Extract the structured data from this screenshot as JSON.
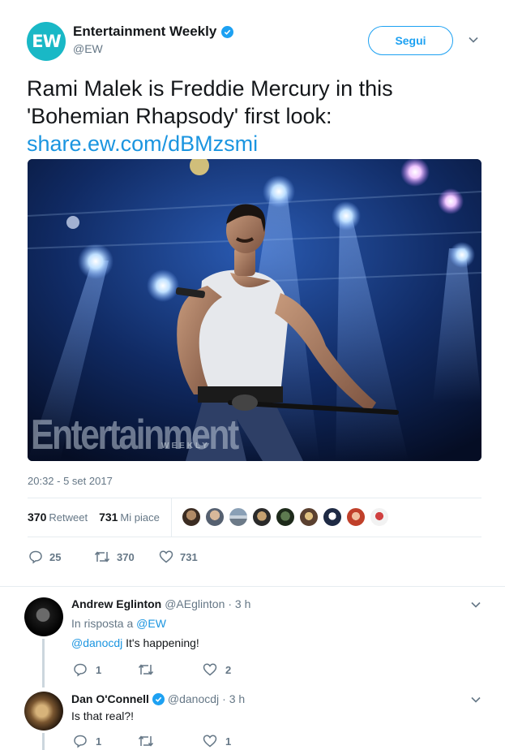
{
  "tweet": {
    "author": {
      "name": "Entertainment Weekly",
      "handle": "@EW",
      "avatar_text": "EW",
      "verified": true
    },
    "follow_label": "Segui",
    "text": "Rami Malek is Freddie Mercury in this 'Bohemian Rhapsody' first look:",
    "link": "share.ew.com/dBMzsmi",
    "image": {
      "watermark": "Entertainment",
      "watermark_sub": "WEEKLY"
    },
    "timestamp": "20:32 - 5 set 2017",
    "stats": {
      "retweets_count": "370",
      "retweets_label": "Retweet",
      "likes_count": "731",
      "likes_label": "Mi piace"
    },
    "actions": {
      "reply": "25",
      "retweet": "370",
      "like": "731"
    }
  },
  "replies": [
    {
      "name": "Andrew Eglinton",
      "handle": "@AEglinton",
      "time": "· 3 h",
      "reply_to_prefix": "In risposta a",
      "reply_to": "@EW",
      "mention": "@danocdj",
      "text": "It's happening!",
      "reply_count": "1",
      "retweet_count": "",
      "like_count": "2"
    },
    {
      "name": "Dan O'Connell",
      "handle": "@danocdj",
      "time": "· 3 h",
      "verified": true,
      "text": "Is that real?!",
      "reply_count": "1",
      "retweet_count": "",
      "like_count": "1"
    }
  ],
  "colors": {
    "accent": "#1da1f2",
    "link": "#1b95e0",
    "muted": "#657786",
    "brand_ew": "#19b8c6",
    "like_red": "#e0245e"
  }
}
